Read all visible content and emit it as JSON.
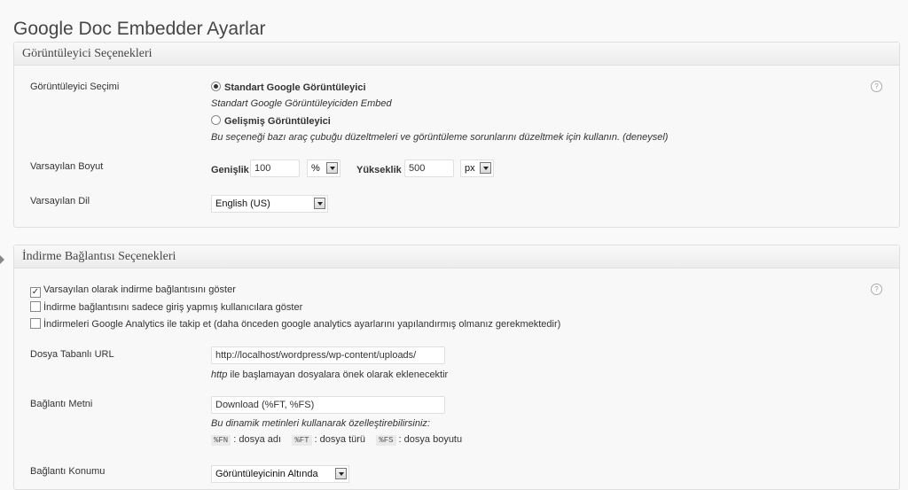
{
  "page": {
    "title": "Google Doc Embedder Ayarlar"
  },
  "viewer_section": {
    "title": "Görüntüleyici Seçenekleri",
    "viewer_choice": {
      "label": "Görüntüleyici Seçimi",
      "option1": "Standart Google Görüntüleyici",
      "option1_desc": "Standart Google Görüntüleyiciden Embed",
      "option2": "Gelişmiş Görüntüleyici",
      "option2_desc": "Bu seçeneği bazı araç çubuğu düzeltmeleri ve görüntüleme sorunlarını düzeltmek için kullanın. (deneysel)",
      "selected": "option1"
    },
    "default_size": {
      "label": "Varsayılan Boyut",
      "width_label": "Genişlik",
      "width_value": "100",
      "width_unit": "%",
      "height_label": "Yükseklik",
      "height_value": "500",
      "height_unit": "px"
    },
    "default_lang": {
      "label": "Varsayılan Dil",
      "value": "English (US)"
    },
    "help": "?"
  },
  "download_section": {
    "title": "İndirme Bağlantısı Seçenekleri",
    "checkboxes": [
      {
        "label": "Varsayılan olarak indirme bağlantısını göster",
        "checked": true
      },
      {
        "label": "İndirme bağlantısını sadece giriş yapmış kullanıcılara göster",
        "checked": false
      },
      {
        "label": "İndirmeleri Google Analytics ile takip et (daha önceden google analytics ayarlarını yapılandırmış olmanız gerekmektedir)",
        "checked": false
      }
    ],
    "base_url": {
      "label": "Dosya Tabanlı URL",
      "value": "http://localhost/wordpress/wp-content/uploads/",
      "hint_em": "http",
      "hint_rest": " ile başlamayan dosyalara önek olarak eklenecektir"
    },
    "link_text": {
      "label": "Bağlantı Metni",
      "value": "Download (%FT, %FS)",
      "hint": "Bu dinamik metinleri kullanarak özelleştirebilirsiniz:",
      "tokens": [
        {
          "code": "%FN",
          "desc": " : dosya adı"
        },
        {
          "code": "%FT",
          "desc": " : dosya türü"
        },
        {
          "code": "%FS",
          "desc": " : dosya boyutu"
        }
      ]
    },
    "link_position": {
      "label": "Bağlantı Konumu",
      "value": "Görüntüleyicinin Altında"
    },
    "help": "?"
  }
}
